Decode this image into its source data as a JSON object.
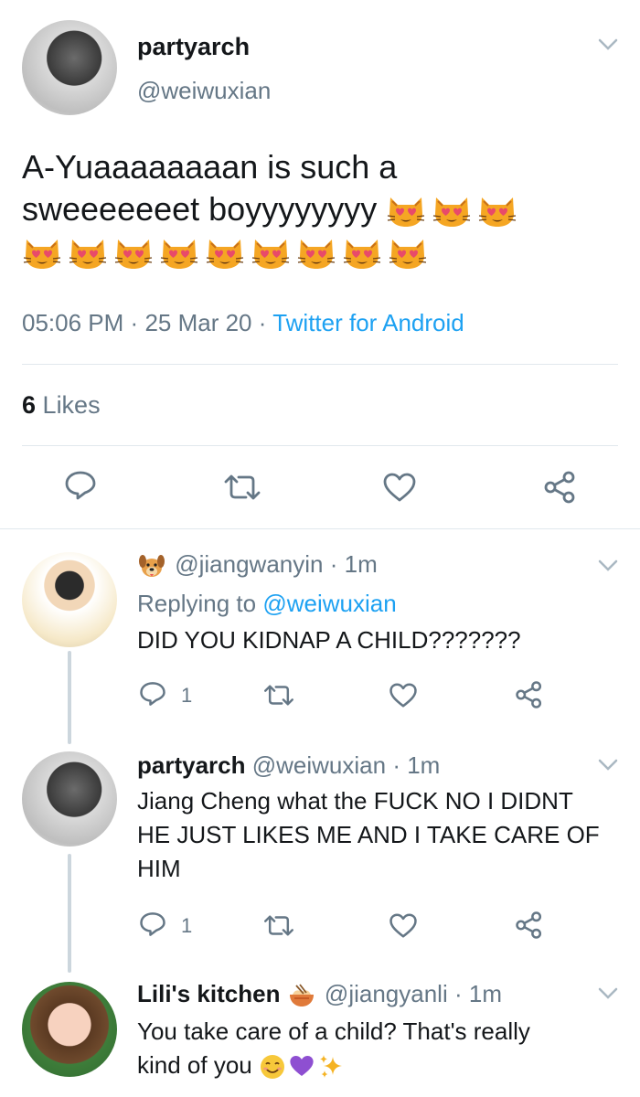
{
  "main_tweet": {
    "display_name": "partyarch",
    "handle": "@weiwuxian",
    "text_line1": "A-Yuaaaaaaaan is such a",
    "text_line2": "sweeeeeeet boyyyyyyyy",
    "time": "05:06 PM",
    "date": "25 Mar 20",
    "source": "Twitter for Android",
    "likes_count": "6",
    "likes_label": "Likes"
  },
  "replies": [
    {
      "handle": "@jiangwanyin",
      "time": "1m",
      "replying_prefix": "Replying to",
      "replying_handle": "@weiwuxian",
      "text": "DID YOU KIDNAP A CHILD???????",
      "reply_count": "1"
    },
    {
      "display_name": "partyarch",
      "handle": "@weiwuxian",
      "time": "1m",
      "text_line1": "Jiang Cheng what the FUCK NO I DIDNT",
      "text_line2": "HE JUST LIKES ME AND I TAKE CARE OF",
      "text_line3": "HIM",
      "reply_count": "1"
    },
    {
      "display_name": "Lili's kitchen",
      "handle": "@jiangyanli",
      "time": "1m",
      "text_line1": "You take care of a child? That's really",
      "text_line2": "kind of you"
    }
  ],
  "separator": "·",
  "colors": {
    "accent": "#1da1f2",
    "secondary_text": "#657786",
    "divider": "#e1e8ed",
    "thread_line": "#ccd6dd"
  }
}
